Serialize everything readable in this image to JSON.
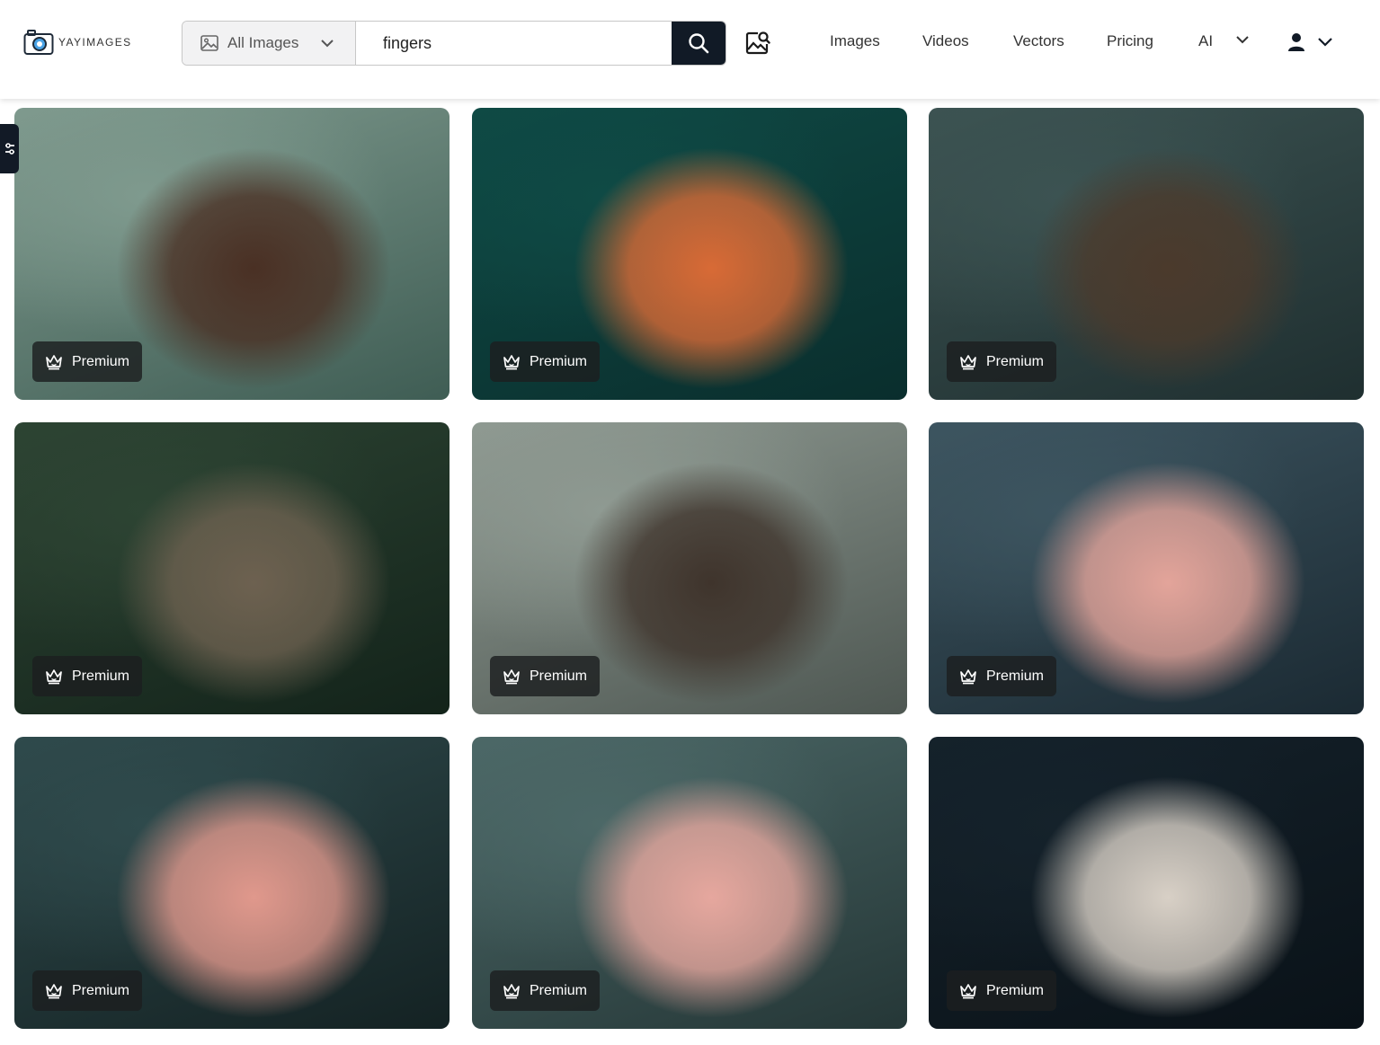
{
  "brand": {
    "name": "YAYIMAGES",
    "icon": "camera-logo-icon"
  },
  "search": {
    "type_label": "All Images",
    "query": "fingers",
    "icons": {
      "type": "image-icon",
      "submit": "search-icon",
      "visual": "image-search-icon"
    }
  },
  "nav": {
    "items": [
      "Images",
      "Videos",
      "Vectors",
      "Pricing",
      "AI"
    ],
    "account_icon": "user-icon"
  },
  "filter_tab_icon": "filter-icon",
  "accent_color": "#111a26",
  "results": [
    {
      "badge": "Premium",
      "palette": [
        "#7f9a8e",
        "#3f5d54",
        "#4a3024"
      ]
    },
    {
      "badge": "Premium",
      "palette": [
        "#0f4a45",
        "#0a2e2d",
        "#d86a36"
      ]
    },
    {
      "badge": "Premium",
      "palette": [
        "#3c5352",
        "#1f2f30",
        "#4b3a2c"
      ]
    },
    {
      "badge": "Premium",
      "palette": [
        "#2d4433",
        "#13231a",
        "#6d6150"
      ]
    },
    {
      "badge": "Premium",
      "palette": [
        "#8f9a92",
        "#4e5752",
        "#3f342c"
      ]
    },
    {
      "badge": "Premium",
      "palette": [
        "#3d5560",
        "#1b2a33",
        "#e3a49a"
      ]
    },
    {
      "badge": "Premium",
      "palette": [
        "#2f4a4c",
        "#142223",
        "#e0988c"
      ]
    },
    {
      "badge": "Premium",
      "palette": [
        "#4c6867",
        "#253737",
        "#e6a79e"
      ]
    },
    {
      "badge": "Premium",
      "palette": [
        "#15222b",
        "#0a1218",
        "#d8d0c6"
      ]
    }
  ]
}
